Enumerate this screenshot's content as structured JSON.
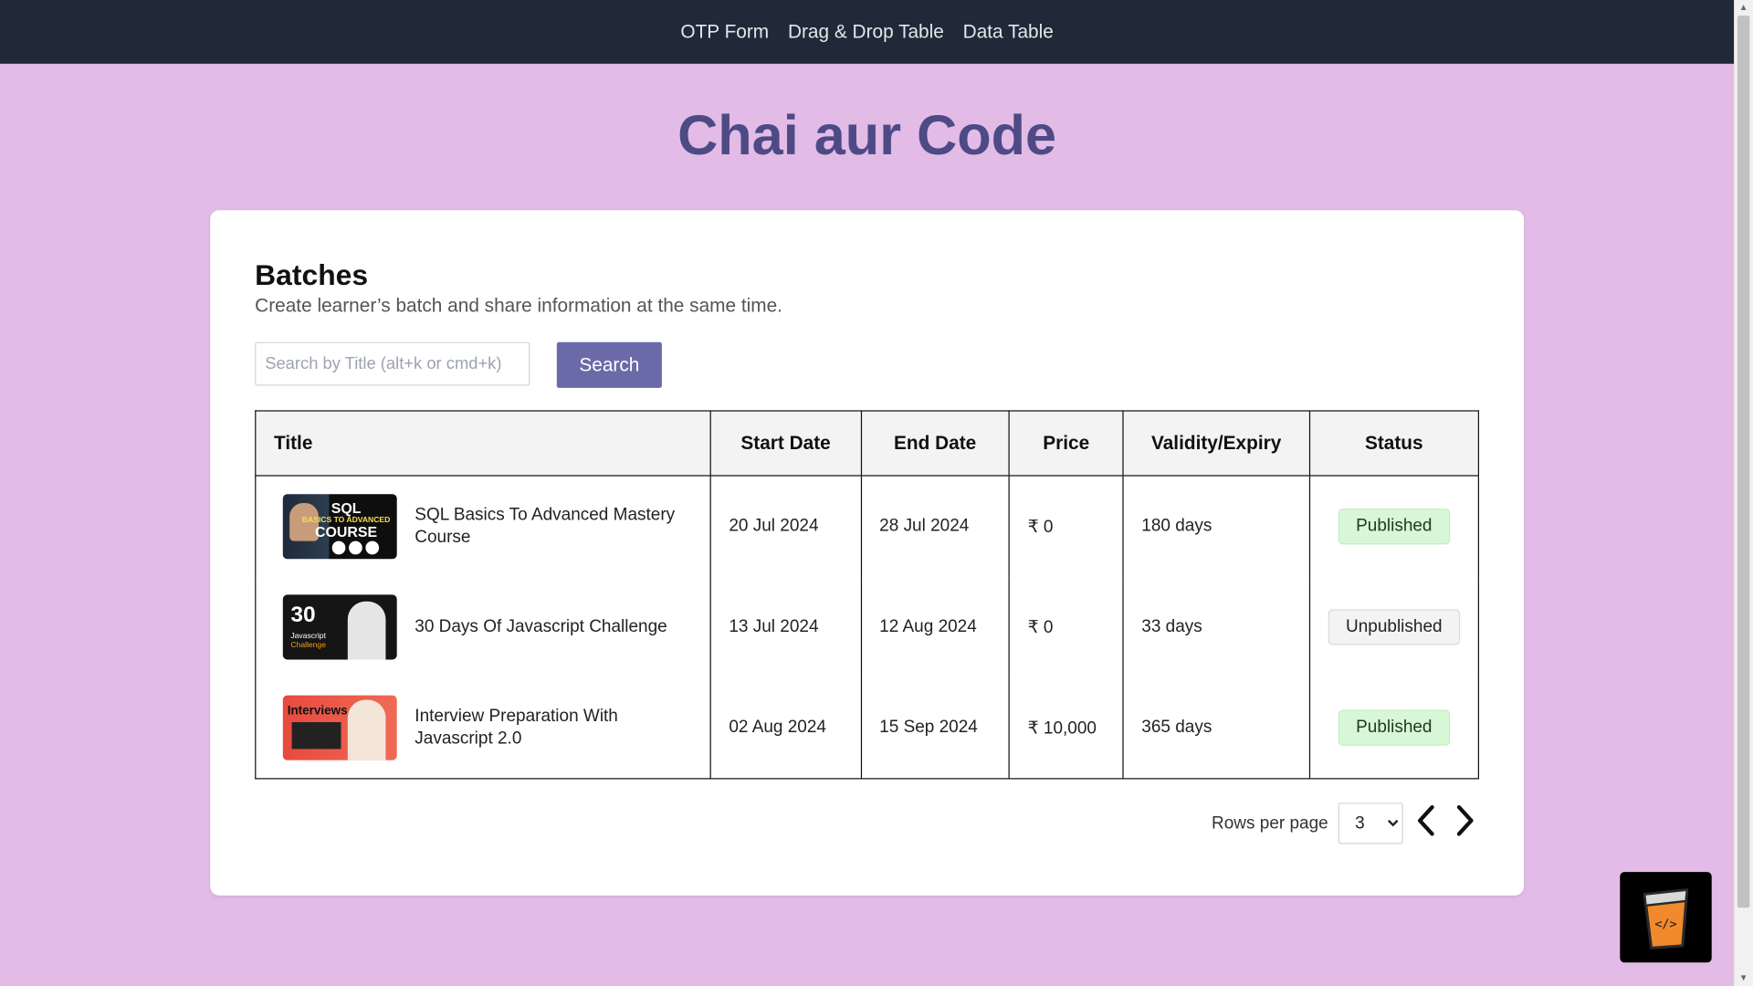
{
  "nav": {
    "links": [
      "OTP Form",
      "Drag & Drop Table",
      "Data Table"
    ]
  },
  "brand": {
    "title": "Chai aur Code"
  },
  "card": {
    "title": "Batches",
    "subtitle": "Create learner’s batch and share information at the same time.",
    "search": {
      "placeholder": "Search by Title (alt+k or cmd+k)",
      "value": "",
      "button_label": "Search"
    },
    "table": {
      "headers": [
        "Title",
        "Start Date",
        "End Date",
        "Price",
        "Validity/Expiry",
        "Status"
      ],
      "rows": [
        {
          "title": "SQL Basics To Advanced Mastery Course",
          "start": "20 Jul 2024",
          "end": "28 Jul 2024",
          "price": "₹ 0",
          "validity": "180 days",
          "status": "Published",
          "thumb": {
            "line1": "SQL",
            "line2": "BASICS TO ADVANCED",
            "line3": "COURSE"
          }
        },
        {
          "title": "30 Days Of Javascript Challenge",
          "start": "13 Jul 2024",
          "end": "12 Aug 2024",
          "price": "₹ 0",
          "validity": "33 days",
          "status": "Unpublished",
          "thumb": {
            "line1": "30",
            "line2": "Javascript",
            "line3": "Challenge"
          }
        },
        {
          "title": "Interview Preparation With Javascript 2.0",
          "start": "02 Aug 2024",
          "end": "15 Sep 2024",
          "price": "₹ 10,000",
          "validity": "365 days",
          "status": "Published",
          "thumb": {
            "line1": "Interviews"
          }
        }
      ]
    },
    "pagination": {
      "rows_per_page_label": "Rows per page",
      "rows_per_page": "3",
      "prev_icon": "chevron-left-icon",
      "next_icon": "chevron-right-icon"
    }
  },
  "colors": {
    "nav_bg": "#1f2937",
    "page_bg": "#e2bbe7",
    "brand": "#4d4a85",
    "button": "#6b6aa9",
    "published_bg": "#d9f7d6"
  },
  "fab": {
    "icon": "chai-cup-icon"
  }
}
